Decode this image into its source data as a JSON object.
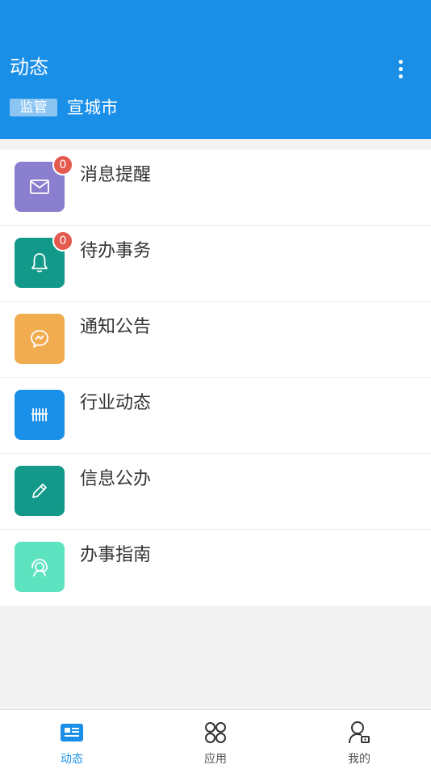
{
  "header": {
    "title": "动态",
    "tag": "监管",
    "city": "宣城市",
    "more_icon": "more-vertical-icon"
  },
  "colors": {
    "primary": "#1a8fe8",
    "badge": "#e45a4f"
  },
  "items": [
    {
      "label": "消息提醒",
      "icon": "mail-icon",
      "color": "#8a7fcf",
      "badge": "0"
    },
    {
      "label": "待办事务",
      "icon": "bell-icon",
      "color": "#13998a",
      "badge": "0"
    },
    {
      "label": "通知公告",
      "icon": "chat-bubble-icon",
      "color": "#f0ac4f"
    },
    {
      "label": "行业动态",
      "icon": "barcode-icon",
      "color": "#1a8fe8"
    },
    {
      "label": "信息公办",
      "icon": "pencil-icon",
      "color": "#13998a"
    },
    {
      "label": "办事指南",
      "icon": "headset-icon",
      "color": "#5ee3c1"
    }
  ],
  "tabs": [
    {
      "label": "动态",
      "icon": "news-icon",
      "active": true
    },
    {
      "label": "应用",
      "icon": "apps-icon",
      "active": false
    },
    {
      "label": "我的",
      "icon": "user-icon",
      "active": false
    }
  ]
}
